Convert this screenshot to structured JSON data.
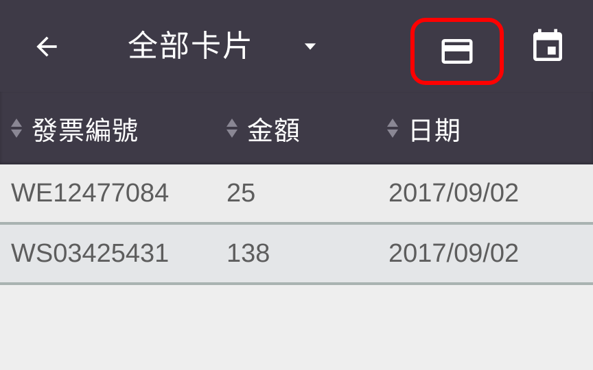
{
  "toolbar": {
    "back_icon": "arrow-left-icon",
    "title": "全部卡片",
    "dropdown_icon": "caret-down-icon",
    "card_icon": "credit-card-icon",
    "calendar_icon": "calendar-icon",
    "background_color": "#3e3a47",
    "highlight_color": "#ff0000"
  },
  "table": {
    "columns": [
      {
        "label": "發票編號",
        "sort_icon": "sort-icon"
      },
      {
        "label": "金額",
        "sort_icon": "sort-icon"
      },
      {
        "label": "日期",
        "sort_icon": "sort-icon"
      }
    ],
    "rows": [
      {
        "invoice": "WE12477084",
        "amount": "25",
        "date": "2017/09/02"
      },
      {
        "invoice": "WS03425431",
        "amount": "138",
        "date": "2017/09/02"
      }
    ]
  }
}
